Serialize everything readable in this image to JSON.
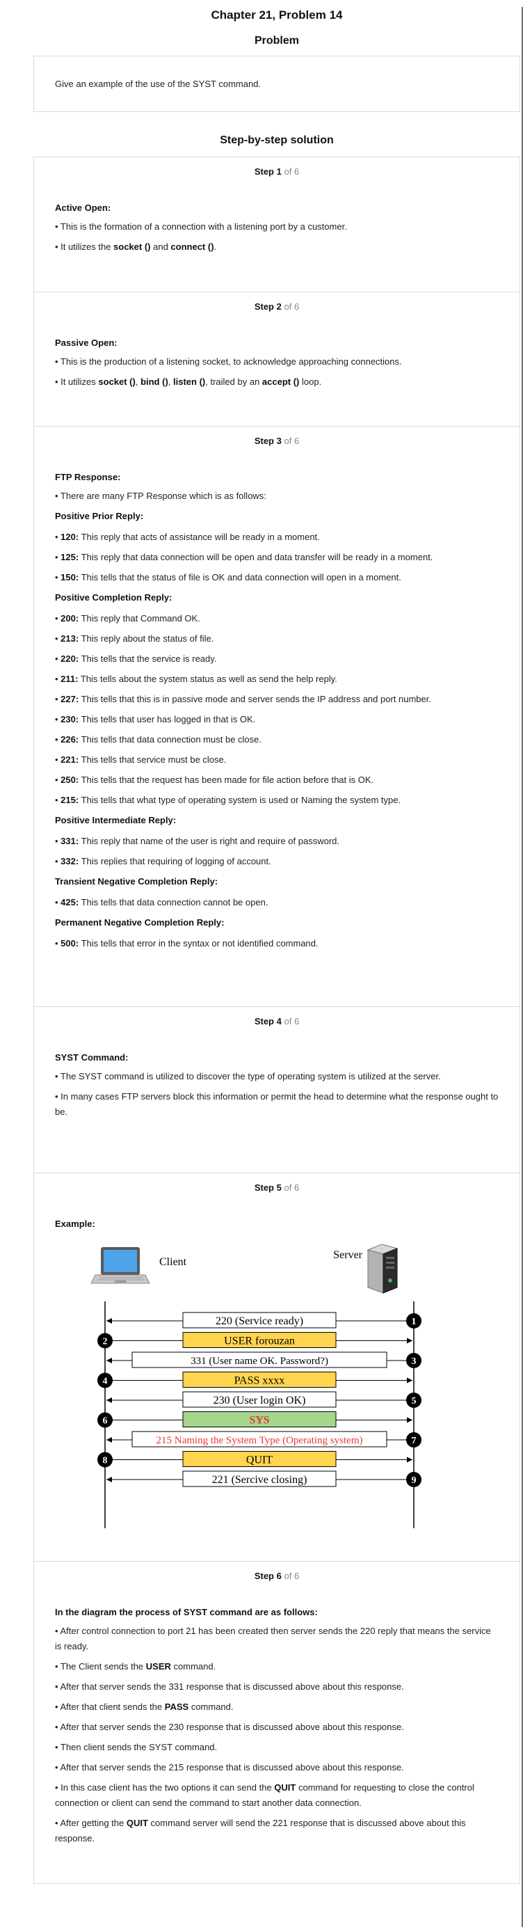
{
  "title": "Chapter 21, Problem 14",
  "problem": {
    "heading": "Problem",
    "text": "Give an example of the use of the SYST command."
  },
  "solution": {
    "heading": "Step-by-step solution",
    "of_total": "of 6",
    "step_label": "Step",
    "steps": [
      {
        "num": "1"
      },
      {
        "num": "2"
      },
      {
        "num": "3"
      },
      {
        "num": "4"
      },
      {
        "num": "5"
      },
      {
        "num": "6"
      }
    ]
  },
  "step1": {
    "heading": "Active Open:",
    "b1": "• This is the formation of a connection with a listening port by a customer.",
    "b2_pre": "• It utilizes the ",
    "b2_k1": "socket ()",
    "b2_mid": " and ",
    "b2_k2": "connect ()",
    "b2_end": "."
  },
  "step2": {
    "heading": "Passive Open:",
    "b1": "• This is the production of a listening socket, to acknowledge approaching connections.",
    "b2_pre": "• It utilizes ",
    "b2_k1": "socket ()",
    "b2_c1": ", ",
    "b2_k2": "bind ()",
    "b2_c2": ", ",
    "b2_k3": "listen ()",
    "b2_mid": ", trailed by an ",
    "b2_k4": "accept ()",
    "b2_end": " loop."
  },
  "step3": {
    "heading": "FTP Response:",
    "intro": "• There are many FTP Response which is as follows:",
    "groups": [
      {
        "title": "Positive Prior Reply:",
        "items": [
          {
            "code": "120:",
            "text": " This reply that acts of assistance will be ready in a moment."
          },
          {
            "code": "125:",
            "text": " This reply that data connection will be open and data transfer will be ready in a moment."
          },
          {
            "code": "150:",
            "text": " This tells that the status of file is OK and data connection will open in a moment."
          }
        ]
      },
      {
        "title": "Positive Completion Reply:",
        "items": [
          {
            "code": "200:",
            "text": " This reply that Command OK."
          },
          {
            "code": "213:",
            "text": " This reply about the status of file."
          },
          {
            "code": "220:",
            "text": " This tells that the service is ready."
          },
          {
            "code": "211:",
            "text": " This tells about the system status as well as send the help reply."
          },
          {
            "code": "227:",
            "text": " This tells that this is in passive mode and server sends the IP address and port number."
          },
          {
            "code": "230:",
            "text": " This tells that user has logged in that is OK."
          },
          {
            "code": "226:",
            "text": " This tells that data connection must be close."
          },
          {
            "code": "221:",
            "text": " This tells that service must be close."
          },
          {
            "code": "250:",
            "text": " This tells that the request has been made for file action before that is OK."
          },
          {
            "code": "215:",
            "text": " This tells that what type of operating system is used or Naming the system type."
          }
        ]
      },
      {
        "title": "Positive Intermediate Reply:",
        "items": [
          {
            "code": "331:",
            "text": " This reply that name of the user is right and require of password."
          },
          {
            "code": "332:",
            "text": " This replies that requiring of logging of account."
          }
        ]
      },
      {
        "title": "Transient Negative Completion Reply:",
        "items": [
          {
            "code": "425:",
            "text": " This tells that data connection cannot be open."
          }
        ]
      },
      {
        "title": "Permanent Negative Completion Reply:",
        "items": [
          {
            "code": "500:",
            "text": " This tells that error in the syntax or not identified command."
          }
        ]
      }
    ]
  },
  "step4": {
    "heading": "SYST Command:",
    "b1": "• The SYST command is utilized to discover the type of operating system is utilized at the server.",
    "b2": "• In many cases FTP servers block this information or permit the head to determine what the response ought to be."
  },
  "step5": {
    "heading": "Example:",
    "diagram": {
      "client_label": "Client",
      "server_label": "Server",
      "colors": {
        "yellow": "#ffd54f",
        "green": "#a5d68a",
        "red": "#e53935",
        "black": "#000000"
      },
      "messages": [
        {
          "num": "1",
          "label": "220 (Service ready)",
          "dir": "to-client",
          "side": "server",
          "fill": "#ffffff",
          "text_color": "#000000"
        },
        {
          "num": "2",
          "label": "USER forouzan",
          "dir": "to-server",
          "side": "client",
          "fill": "#ffd54f",
          "text_color": "#000000"
        },
        {
          "num": "3",
          "label": "331 (User name OK. Password?)",
          "dir": "to-client",
          "side": "server",
          "fill": "#ffffff",
          "text_color": "#000000"
        },
        {
          "num": "4",
          "label": "PASS xxxx",
          "dir": "to-server",
          "side": "client",
          "fill": "#ffd54f",
          "text_color": "#000000"
        },
        {
          "num": "5",
          "label": "230 (User login OK)",
          "dir": "to-client",
          "side": "server",
          "fill": "#ffffff",
          "text_color": "#000000"
        },
        {
          "num": "6",
          "label": "SYS",
          "dir": "to-server",
          "side": "client",
          "fill": "#a5d68a",
          "text_color": "#e53935"
        },
        {
          "num": "7",
          "label": "215 Naming the System Type (Operating system)",
          "dir": "to-client",
          "side": "server",
          "fill": "#ffffff",
          "text_color": "#e53935"
        },
        {
          "num": "8",
          "label": "QUIT",
          "dir": "to-server",
          "side": "client",
          "fill": "#ffd54f",
          "text_color": "#000000"
        },
        {
          "num": "9",
          "label": "221 (Sercive closing)",
          "dir": "to-client",
          "side": "server",
          "fill": "#ffffff",
          "text_color": "#000000"
        }
      ]
    }
  },
  "step6": {
    "heading": "In the diagram the process of SYST command are as follows:",
    "b1": "• After control connection to port 21 has been created then server sends the 220 reply that means the service is ready.",
    "b2_pre": "• The Client sends the ",
    "b2_k": "USER",
    "b2_end": " command.",
    "b3": "• After that server sends the 331 response that is discussed above about this response.",
    "b4_pre": "• After that client sends the ",
    "b4_k": "PASS",
    "b4_end": " command.",
    "b5": "• After that server sends the 230 response that is discussed above about this response.",
    "b6": "• Then client sends the SYST command.",
    "b7": "• After that server sends the 215 response that is discussed above about this response.",
    "b8_pre": "• In this case client has the two options it can send the ",
    "b8_k": "QUIT",
    "b8_end": " command for requesting to close the control connection or client can send the command to start another data connection.",
    "b9_pre": "• After getting the ",
    "b9_k": "QUIT",
    "b9_end": " command server will send the 221 response that is discussed above about this response."
  }
}
